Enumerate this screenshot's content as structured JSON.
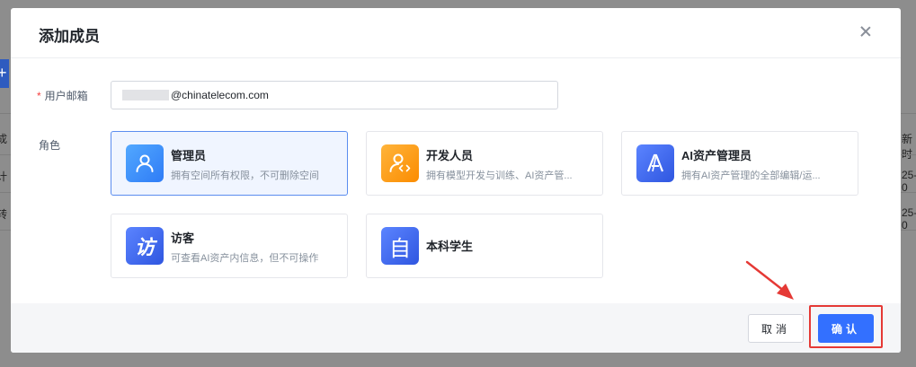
{
  "background": {
    "left_button_glyph": "+",
    "left_texts": [
      "成",
      "计",
      "转"
    ],
    "right_texts": [
      "新时",
      "25-0",
      "25-0"
    ]
  },
  "modal": {
    "title": "添加成员",
    "email": {
      "required_mark": "*",
      "label": "用户邮箱",
      "value_suffix": "@chinatelecom.com"
    },
    "role_label": "角色",
    "roles": [
      {
        "name": "管理员",
        "desc": "拥有空间所有权限，不可删除空间",
        "icon": "person-icon",
        "selected": true,
        "color": "#3d8bff"
      },
      {
        "name": "开发人员",
        "desc": "拥有模型开发与训练、AI资产管...",
        "icon": "developer-icon",
        "selected": false,
        "color": "#ff9d1a"
      },
      {
        "name": "AI资产管理员",
        "desc": "拥有AI资产管理的全部编辑/运...",
        "icon": "ai-letter-icon",
        "selected": false,
        "color": "#3d6df2"
      },
      {
        "name": "访客",
        "desc": "可查看AI资产内信息，但不可操作",
        "icon": "visitor-glyph-icon",
        "glyph": "访",
        "selected": false,
        "color": "#3d6df2"
      },
      {
        "name": "本科学生",
        "desc": "",
        "icon": "student-glyph-icon",
        "glyph": "自",
        "selected": false,
        "color": "#3d6df2"
      }
    ],
    "footer": {
      "cancel_label": "取消",
      "confirm_label": "确认"
    }
  },
  "colors": {
    "primary": "#3370ff",
    "annotation_red": "#e53935",
    "selected_border": "#5b8def"
  }
}
